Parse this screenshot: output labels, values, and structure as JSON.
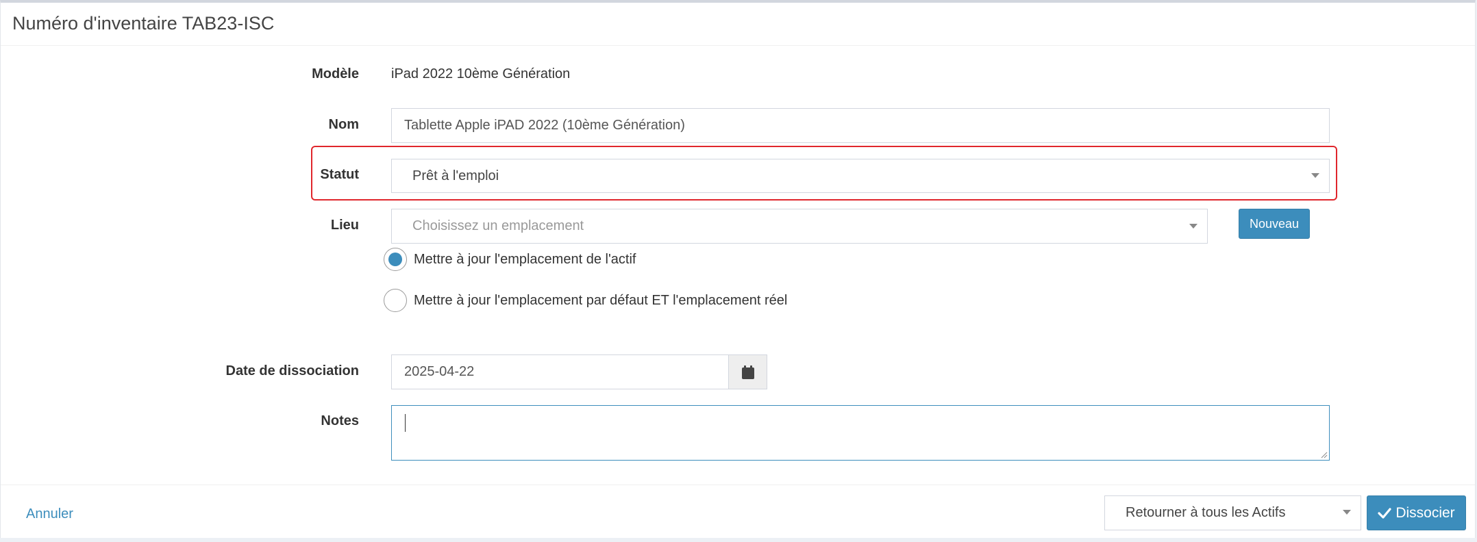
{
  "header": {
    "title": "Numéro d'inventaire TAB23-ISC"
  },
  "form": {
    "model": {
      "label": "Modèle",
      "value": "iPad 2022 10ème Génération"
    },
    "name": {
      "label": "Nom",
      "value": "Tablette Apple iPAD 2022 (10ème Génération)"
    },
    "status": {
      "label": "Statut",
      "selected": "Prêt à l'emploi"
    },
    "location": {
      "label": "Lieu",
      "placeholder": "Choisissez un emplacement",
      "new_button": "Nouveau",
      "options": [
        {
          "label": "Mettre à jour l'emplacement de l'actif",
          "checked": true
        },
        {
          "label": "Mettre à jour l'emplacement par défaut ET l'emplacement réel",
          "checked": false
        }
      ]
    },
    "checkin_date": {
      "label": "Date de dissociation",
      "value": "2025-04-22",
      "icon": "calendar-icon"
    },
    "notes": {
      "label": "Notes",
      "value": ""
    }
  },
  "footer": {
    "cancel_label": "Annuler",
    "redirect_selected": "Retourner à tous les Actifs",
    "submit_label": "Dissocier",
    "submit_icon": "check-icon"
  },
  "colors": {
    "primary": "#3c8dbc",
    "highlight": "#e0262c"
  }
}
